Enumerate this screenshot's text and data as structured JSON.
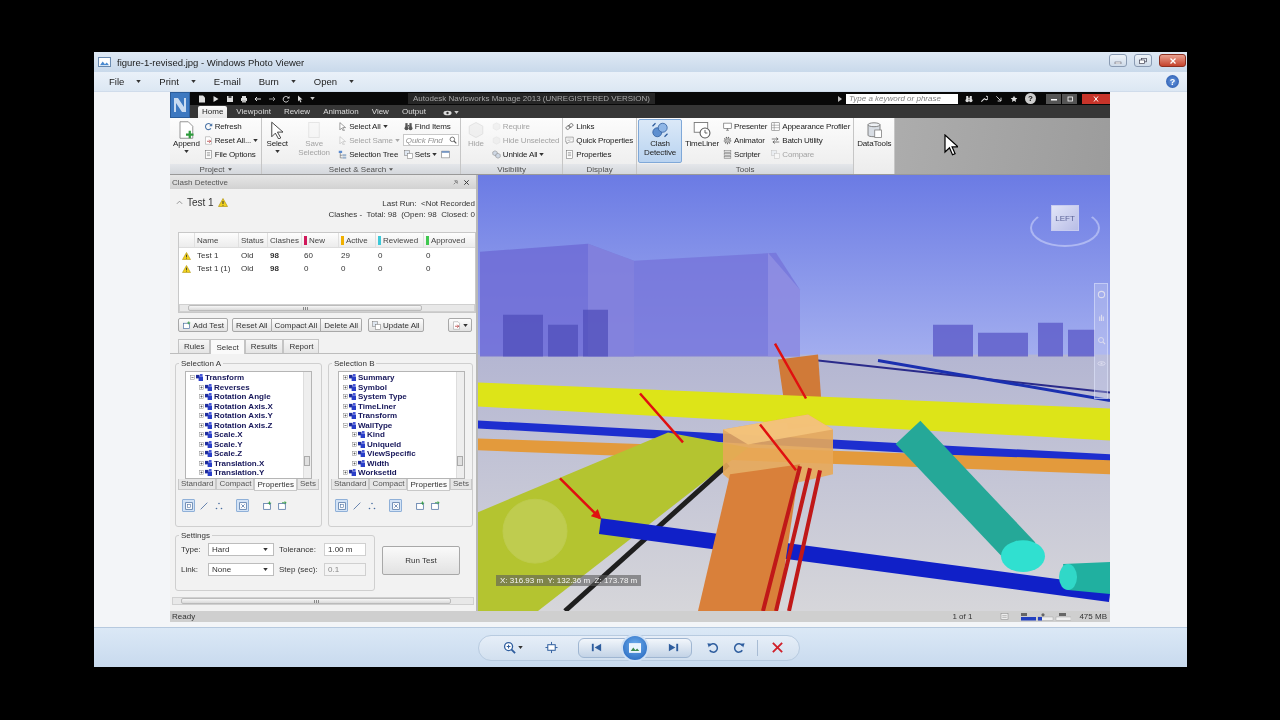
{
  "window": {
    "title": "figure-1-revised.jpg - Windows Photo Viewer"
  },
  "menu": [
    {
      "label": "File",
      "dropdown": true
    },
    {
      "label": "Print",
      "dropdown": true
    },
    {
      "label": "E-mail",
      "dropdown": false
    },
    {
      "label": "Burn",
      "dropdown": true
    },
    {
      "label": "Open",
      "dropdown": true
    }
  ],
  "help": "?",
  "app": {
    "title": "Autodesk Navisworks Manage 2013 (UNREGISTERED VERSION)",
    "search": {
      "placeholder": "Type a keyword or phrase"
    },
    "help": "?",
    "tabs": [
      {
        "label": "Home",
        "selected": true
      },
      {
        "label": "Viewpoint",
        "selected": false
      },
      {
        "label": "Review",
        "selected": false
      },
      {
        "label": "Animation",
        "selected": false
      },
      {
        "label": "View",
        "selected": false
      },
      {
        "label": "Output",
        "selected": false
      }
    ],
    "ribbon": [
      {
        "label": "Project",
        "dropdown": true,
        "columns": [
          [
            {
              "kind": "large",
              "label": "Append",
              "dropdown": true,
              "disabled": false,
              "active": false
            }
          ],
          [
            {
              "kind": "small",
              "label": "Refresh",
              "dropdown": false,
              "disabled": false,
              "active": false
            },
            {
              "kind": "small",
              "label": "Reset All...",
              "dropdown": true,
              "disabled": false,
              "active": false
            },
            {
              "kind": "small",
              "label": "File Options",
              "dropdown": false,
              "disabled": false,
              "active": false
            }
          ]
        ]
      },
      {
        "label": "Select & Search",
        "dropdown": true,
        "columns": [
          [
            {
              "kind": "large",
              "label": "Select",
              "dropdown": true,
              "disabled": false,
              "active": false
            }
          ],
          [
            {
              "kind": "large",
              "label": "Save Selection",
              "dropdown": false,
              "disabled": true,
              "active": false
            }
          ],
          [
            {
              "kind": "small",
              "label": "Select All",
              "dropdown": true,
              "disabled": false,
              "active": false
            },
            {
              "kind": "small",
              "label": "Select Same",
              "dropdown": true,
              "disabled": true,
              "active": false
            },
            {
              "kind": "small",
              "label": "Selection Tree",
              "dropdown": false,
              "disabled": false,
              "active": false
            }
          ],
          [
            {
              "kind": "small",
              "label": "Find Items",
              "dropdown": false,
              "disabled": false,
              "active": false
            },
            {
              "kind": "field",
              "placeholder": "Quick Find",
              "dropdown": false,
              "disabled": false,
              "active": false
            },
            [
              {
                "kind": "small",
                "label": "Sets",
                "dropdown": true,
                "disabled": false,
                "active": false
              },
              {
                "kind": "icon",
                "dropdown": false,
                "disabled": false,
                "active": false
              }
            ]
          ]
        ]
      },
      {
        "label": "Visibility",
        "dropdown": false,
        "columns": [
          [
            {
              "kind": "large",
              "label": "Hide",
              "dropdown": false,
              "disabled": true,
              "active": false
            }
          ],
          [
            {
              "kind": "small",
              "label": "Require",
              "dropdown": false,
              "disabled": true,
              "active": false
            },
            {
              "kind": "small",
              "label": "Hide Unselected",
              "dropdown": false,
              "disabled": true,
              "active": false
            },
            {
              "kind": "small",
              "label": "Unhide All",
              "dropdown": true,
              "disabled": false,
              "active": false
            }
          ]
        ]
      },
      {
        "label": "Display",
        "dropdown": false,
        "columns": [
          [
            {
              "kind": "small",
              "label": "Links",
              "dropdown": false,
              "disabled": false,
              "active": false
            },
            {
              "kind": "small",
              "label": "Quick Properties",
              "dropdown": false,
              "disabled": false,
              "active": false
            },
            {
              "kind": "small",
              "label": "Properties",
              "dropdown": false,
              "disabled": false,
              "active": false
            }
          ]
        ]
      },
      {
        "label": "Tools",
        "dropdown": false,
        "columns": [
          [
            {
              "kind": "large",
              "label": "Clash Detective",
              "dropdown": false,
              "disabled": false,
              "active": true
            }
          ],
          [
            {
              "kind": "large",
              "label": "TimeLiner",
              "dropdown": false,
              "disabled": false,
              "active": false
            }
          ],
          [
            {
              "kind": "small",
              "label": "Presenter",
              "dropdown": false,
              "disabled": false,
              "active": false
            },
            {
              "kind": "small",
              "label": "Animator",
              "dropdown": false,
              "disabled": false,
              "active": false
            },
            {
              "kind": "small",
              "label": "Scripter",
              "dropdown": false,
              "disabled": false,
              "active": false
            }
          ],
          [
            {
              "kind": "small",
              "label": "Appearance Profiler",
              "dropdown": false,
              "disabled": false,
              "active": false
            },
            {
              "kind": "small",
              "label": "Batch Utility",
              "dropdown": false,
              "disabled": false,
              "active": false
            },
            {
              "kind": "small",
              "label": "Compare",
              "dropdown": false,
              "disabled": true,
              "active": false
            }
          ]
        ]
      },
      {
        "columns": [
          [
            {
              "kind": "large",
              "label": "DataTools",
              "dropdown": false,
              "disabled": false,
              "active": false
            }
          ]
        ]
      }
    ],
    "clash_detective": {
      "title": "Clash Detective",
      "test": {
        "name": "Test 1",
        "expanded": true,
        "last_run": "Last Run:  <Not Recorded",
        "summary": "Clashes -  Total: 98  (Open: 98  Closed: 0"
      },
      "table": {
        "columns": [
          {
            "label": "Name"
          },
          {
            "label": "Status"
          },
          {
            "label": "Clashes"
          },
          {
            "label": "New",
            "color": "#d0185a"
          },
          {
            "label": "Active",
            "color": "#f0b000"
          },
          {
            "label": "Reviewed",
            "color": "#3cc8d8"
          },
          {
            "label": "Approved",
            "color": "#40c850"
          }
        ],
        "rows": [
          {
            "cells": [
              "Test 1",
              "Old",
              "98",
              "60",
              "29",
              "0",
              "0"
            ]
          },
          {
            "cells": [
              "Test 1 (1)",
              "Old",
              "98",
              "0",
              "0",
              "0",
              "0"
            ]
          }
        ]
      },
      "buttons": [
        "Add Test",
        "Reset All",
        "Compact All",
        "Delete All",
        "Update All"
      ],
      "tabs": [
        {
          "label": "Rules",
          "selected": false
        },
        {
          "label": "Select",
          "selected": true
        },
        {
          "label": "Results",
          "selected": false
        },
        {
          "label": "Report",
          "selected": false
        }
      ],
      "selections": [
        {
          "title": "Selection A",
          "tree": [
            {
              "label": "Transform",
              "expanded": true,
              "children": [
                {
                  "label": "Reverses",
                  "expanded": false
                },
                {
                  "label": "Rotation Angle",
                  "expanded": false
                },
                {
                  "label": "Rotation Axis.X",
                  "expanded": false
                },
                {
                  "label": "Rotation Axis.Y",
                  "expanded": false
                },
                {
                  "label": "Rotation Axis.Z",
                  "expanded": false
                },
                {
                  "label": "Scale.X",
                  "expanded": false
                },
                {
                  "label": "Scale.Y",
                  "expanded": false
                },
                {
                  "label": "Scale.Z",
                  "expanded": false
                },
                {
                  "label": "Translation.X",
                  "expanded": false
                },
                {
                  "label": "Translation.Y",
                  "expanded": false
                }
              ]
            }
          ],
          "tabs": [
            {
              "label": "Standard",
              "selected": false
            },
            {
              "label": "Compact",
              "selected": false
            },
            {
              "label": "Properties",
              "selected": true
            },
            {
              "label": "Sets",
              "selected": false
            }
          ],
          "tools": [
            {
              "selected": true
            },
            {
              "selected": false
            },
            {
              "selected": false
            },
            {
              "selected": true
            },
            {
              "selected": false
            },
            {
              "selected": false
            }
          ]
        },
        {
          "title": "Selection B",
          "tree": [
            {
              "label": "Summary",
              "expanded": false
            },
            {
              "label": "Symbol",
              "expanded": false
            },
            {
              "label": "System Type",
              "expanded": false
            },
            {
              "label": "TimeLiner",
              "expanded": false
            },
            {
              "label": "Transform",
              "expanded": false
            },
            {
              "label": "WallType",
              "expanded": true,
              "children": [
                {
                  "label": "Kind",
                  "expanded": false
                },
                {
                  "label": "UniqueId",
                  "expanded": false
                },
                {
                  "label": "ViewSpecific",
                  "expanded": false
                },
                {
                  "label": "Width",
                  "expanded": false
                }
              ]
            },
            {
              "label": "WorksetId",
              "expanded": false
            }
          ],
          "tabs": [
            {
              "label": "Standard",
              "selected": false
            },
            {
              "label": "Compact",
              "selected": false
            },
            {
              "label": "Properties",
              "selected": true
            },
            {
              "label": "Sets",
              "selected": false
            }
          ],
          "tools": [
            {
              "selected": true
            },
            {
              "selected": false
            },
            {
              "selected": false
            },
            {
              "selected": true
            },
            {
              "selected": false
            },
            {
              "selected": false
            }
          ]
        }
      ],
      "settings": {
        "title": "Settings",
        "fields": [
          {
            "kind": "dropdown",
            "label": "Type:",
            "value": "Hard",
            "disabled": false
          },
          {
            "kind": "text",
            "label": "Tolerance:",
            "value": "1.00 m",
            "disabled": false
          },
          {
            "kind": "dropdown",
            "label": "Link:",
            "value": "None",
            "disabled": false
          },
          {
            "kind": "text",
            "label": "Step (sec):",
            "value": "0.1",
            "disabled": true
          }
        ]
      },
      "run_button": "Run Test"
    },
    "viewport": {
      "viewcube": "LEFT",
      "coordinates": "X: 316.93 m  Y: 132.36 m  Z: 173.78 m"
    },
    "status_bar": {
      "text": "Ready",
      "page": "1 of 1",
      "memory": "475 MB"
    }
  }
}
